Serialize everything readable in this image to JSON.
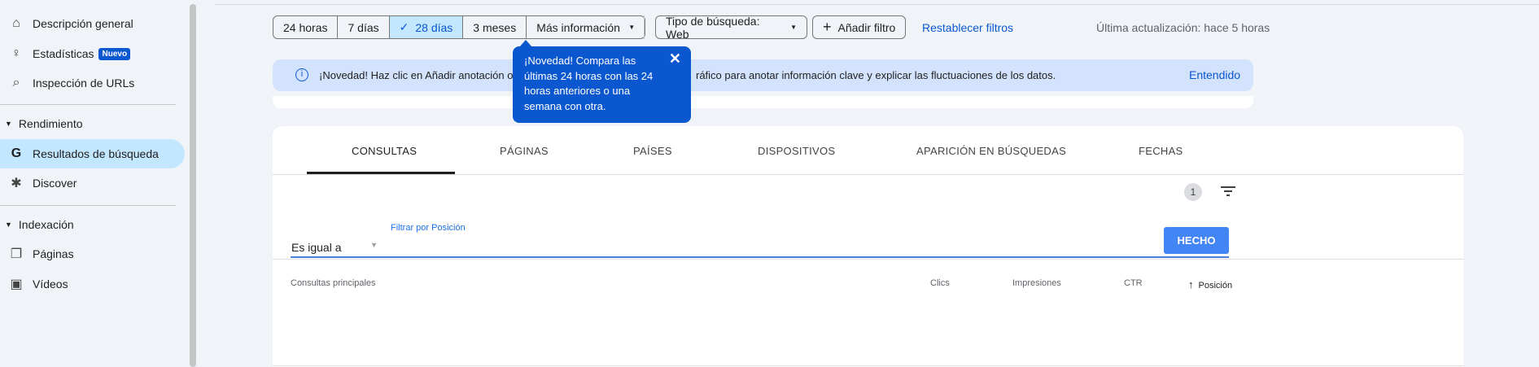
{
  "sidebar": {
    "items": [
      {
        "label": "Descripción general",
        "icon": "home-icon"
      },
      {
        "label": "Estadísticas",
        "badge": "Nuevo",
        "icon": "lightbulb-icon"
      },
      {
        "label": "Inspección de URLs",
        "icon": "search-icon"
      }
    ],
    "section_rendimiento": "Rendimiento",
    "rend_items": [
      {
        "label": "Resultados de búsqueda",
        "icon": "google-icon"
      },
      {
        "label": "Discover",
        "icon": "asterisk-icon"
      }
    ],
    "section_indexacion": "Indexación",
    "idx_items": [
      {
        "label": "Páginas",
        "icon": "pages-icon"
      },
      {
        "label": "Vídeos",
        "icon": "video-icon"
      }
    ]
  },
  "toolbar": {
    "ranges": [
      "24 horas",
      "7 días",
      "28 días",
      "3 meses"
    ],
    "selected": "28 días",
    "more": "Más información",
    "search_type": "Tipo de búsqueda: Web",
    "add_filter": "Añadir filtro",
    "reset": "Restablecer filtros",
    "last_update": "Última actualización: hace 5 horas"
  },
  "banner": {
    "text": "¡Novedad! Haz clic en Añadir anotación o",
    "text_end": "ráfico para anotar información clave y explicar las fluctuaciones de los datos.",
    "action": "Entendido"
  },
  "tooltip": {
    "text": "¡Novedad! Compara las últimas 24 horas con las 24 horas anteriores o una semana con otra."
  },
  "tabs": [
    "CONSULTAS",
    "PÁGINAS",
    "PAÍSES",
    "DISPOSITIVOS",
    "APARICIÓN EN BÚSQUEDAS",
    "FECHAS"
  ],
  "filter": {
    "count": "1",
    "label": "Filtrar por Posición",
    "operator": "Es igual a",
    "value": "",
    "done": "HECHO"
  },
  "table": {
    "headers": [
      "Consultas principales",
      "Clics",
      "Impresiones",
      "CTR",
      "Posición"
    ]
  },
  "colors": {
    "accent": "#0b57d0",
    "selected": "#c2e7ff",
    "button": "#4285f4"
  }
}
